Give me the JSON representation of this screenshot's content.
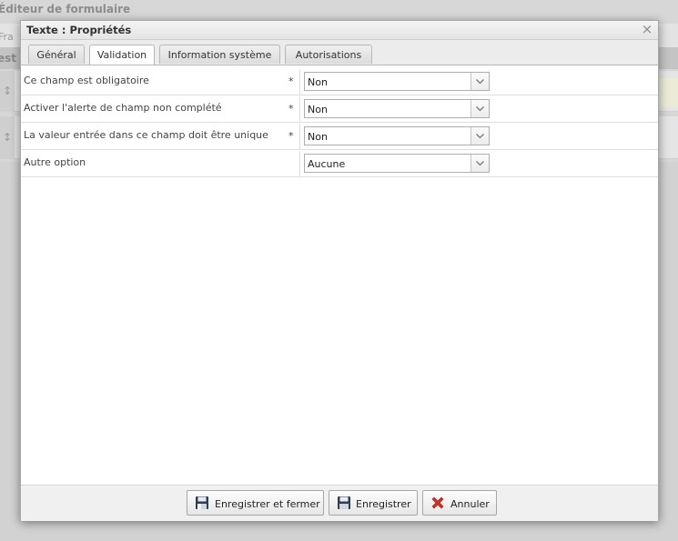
{
  "background": {
    "app_title": "Éditeur de formulaire",
    "toolbar_fragment": "Fra",
    "header_fragment": "est"
  },
  "dialog": {
    "title": "Texte : Propriétés",
    "close_glyph": "×",
    "tabs": [
      {
        "label": "Général"
      },
      {
        "label": "Validation"
      },
      {
        "label": "Information système"
      },
      {
        "label": "Autorisations"
      }
    ],
    "fields": [
      {
        "label": "Ce champ est obligatoire",
        "required_mark": "*",
        "value": "Non"
      },
      {
        "label": "Activer l'alerte de champ non complété",
        "required_mark": "*",
        "value": "Non"
      },
      {
        "label": "La valeur entrée dans ce champ doit être unique",
        "required_mark": "*",
        "value": "Non"
      },
      {
        "label": "Autre option",
        "required_mark": "",
        "value": "Aucune"
      }
    ],
    "footer": {
      "save_close_label": "Enregistrer et fermer",
      "save_label": "Enregistrer",
      "cancel_label": "Annuler"
    }
  },
  "icons": {
    "save_close": "save-close-icon",
    "save": "floppy-disk-icon",
    "cancel": "red-x-icon",
    "dropdown": "chevron-down-icon",
    "drag": "drag-handle-icon"
  },
  "colors": {
    "cancel_red": "#d62d20",
    "floppy_dark": "#2f3d52",
    "overlay_bg": "#c9c9c9"
  }
}
